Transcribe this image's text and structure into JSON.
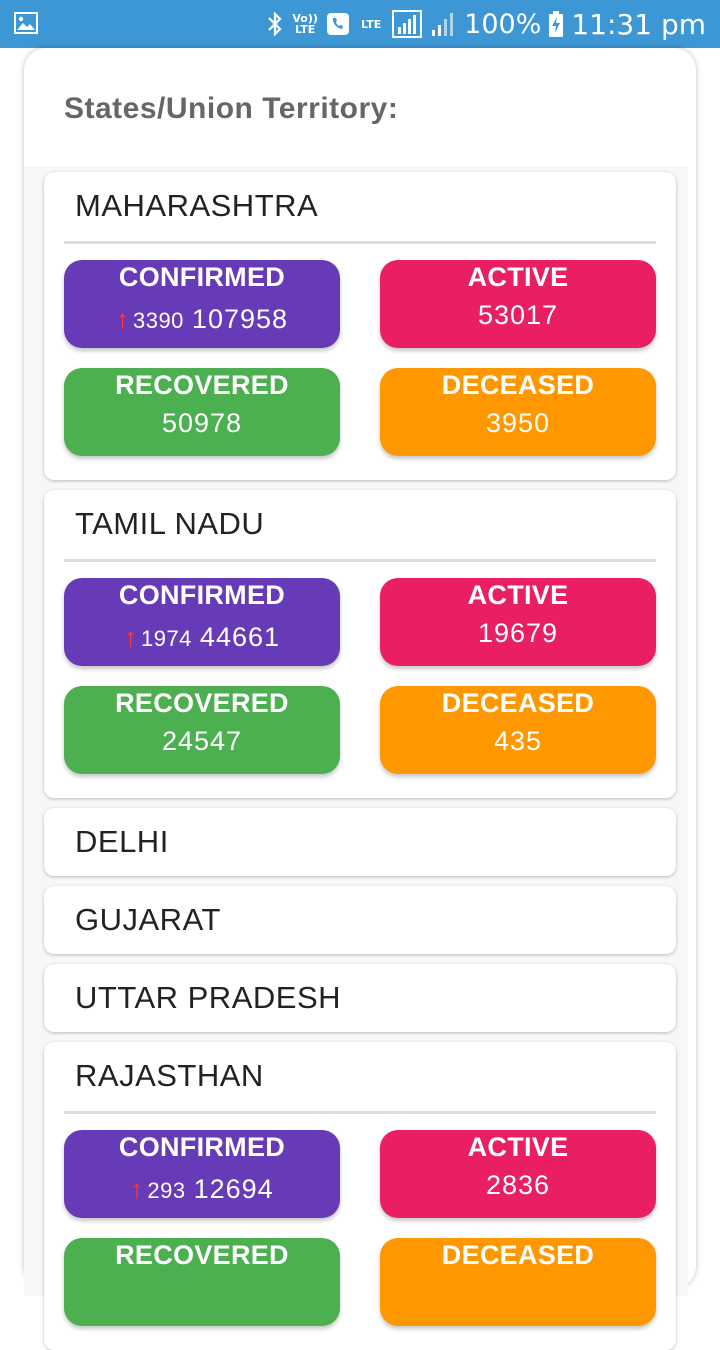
{
  "status_bar": {
    "icons": [
      "gallery-icon",
      "bluetooth-icon",
      "volte-icon",
      "wifi-calling-icon",
      "lte-signal-icon",
      "signal-icon",
      "battery-charging-icon"
    ],
    "volte_text": "Vo)) LTE",
    "lte_text": "LTE",
    "battery": "100%",
    "time": "11:31 pm"
  },
  "header": {
    "title": "States/Union Territory:"
  },
  "labels": {
    "confirmed": "CONFIRMED",
    "active": "ACTIVE",
    "recovered": "RECOVERED",
    "deceased": "DECEASED"
  },
  "colors": {
    "confirmed": "#673ab7",
    "active": "#e91e63",
    "recovered": "#4caf50",
    "deceased": "#ff9800",
    "increase_arrow": "#ff3b3b",
    "status_bar": "#3d97d4"
  },
  "states": [
    {
      "name": "MAHARASHTRA",
      "expanded": true,
      "confirmed_delta": "3390",
      "confirmed": "107958",
      "active": "53017",
      "recovered": "50978",
      "deceased": "3950"
    },
    {
      "name": "TAMIL NADU",
      "expanded": true,
      "confirmed_delta": "1974",
      "confirmed": "44661",
      "active": "19679",
      "recovered": "24547",
      "deceased": "435"
    },
    {
      "name": "DELHI",
      "expanded": false
    },
    {
      "name": "GUJARAT",
      "expanded": false
    },
    {
      "name": "UTTAR PRADESH",
      "expanded": false
    },
    {
      "name": "RAJASTHAN",
      "expanded": true,
      "confirmed_delta": "293",
      "confirmed": "12694",
      "active": "2836"
    }
  ]
}
